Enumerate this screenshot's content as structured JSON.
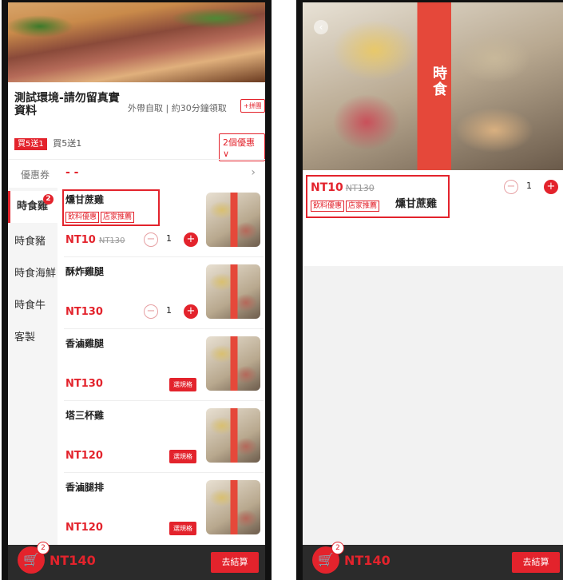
{
  "left": {
    "store_title": "測試環境-請勿留真實資料",
    "store_sub": "外帶自取 | 約30分鐘領取",
    "group_btn": "+拼團",
    "promo_badge": "買5送1",
    "promo_text": "買5送1",
    "offers_btn": "2個優惠∨",
    "coupon_label": "優惠券",
    "coupon_value": "- -",
    "coupon_chevron": "›",
    "sidebar": [
      {
        "label": "時食雞",
        "badge": "2"
      },
      {
        "label": "時食豬"
      },
      {
        "label": "時食海鮮"
      },
      {
        "label": "時食牛"
      },
      {
        "label": "客製"
      }
    ],
    "items": [
      {
        "name": "燻甘蔗雞",
        "tags": [
          "飲料優惠",
          "店家推薦"
        ],
        "price": "NT10",
        "old_price": "NT130",
        "qty": "1"
      },
      {
        "name": "酥炸雞腿",
        "price": "NT130",
        "qty": "1"
      },
      {
        "name": "香滷雞腿",
        "price": "NT130",
        "spec": "選規格"
      },
      {
        "name": "塔三杯雞",
        "price": "NT120",
        "spec": "選規格"
      },
      {
        "name": "香滷腿排",
        "price": "NT120",
        "spec": "選規格"
      }
    ],
    "cart_badge": "2",
    "cart_total": "NT140",
    "checkout": "去結算"
  },
  "right": {
    "back": "‹",
    "box_label": "時食",
    "price": "NT10",
    "old_price": "NT130",
    "tags": [
      "飲料優惠",
      "店家推薦"
    ],
    "name": "燻甘蔗雞",
    "qty": "1",
    "cart_badge": "2",
    "cart_total": "NT140",
    "checkout": "去結算"
  },
  "icons": {
    "minus": "−",
    "plus": "+",
    "cart": "🛒"
  },
  "colors": {
    "accent": "#e3232c",
    "bar": "#2b2b2b"
  }
}
